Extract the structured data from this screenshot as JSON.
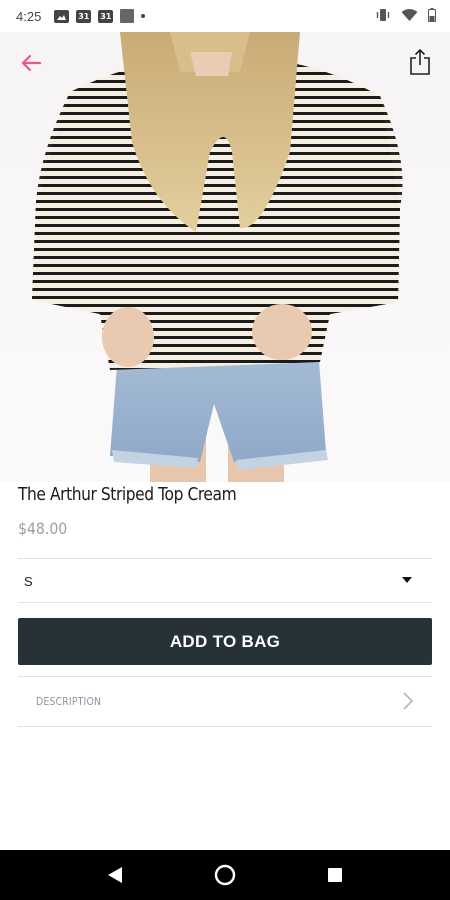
{
  "status_bar": {
    "time": "4:25",
    "icons": [
      "image-icon",
      "calendar-icon",
      "calendar-icon",
      "square-icon",
      "dot-icon",
      "vibrate-icon",
      "wifi-icon",
      "battery-icon"
    ],
    "calendar_day": "31"
  },
  "header": {
    "back_icon": "arrow-left-icon",
    "share_icon": "share-icon",
    "accent_color": "#e8588a"
  },
  "product": {
    "title": "The Arthur Striped Top Cream",
    "price": "$48.00",
    "image": "model-wearing-striped-top-photo"
  },
  "size_selector": {
    "selected": "S"
  },
  "actions": {
    "add_to_bag_label": "ADD TO BAG",
    "button_color": "#263238"
  },
  "description": {
    "label": "DESCRIPTION"
  },
  "nav_bar": {
    "icons": [
      "back-triangle-icon",
      "home-circle-icon",
      "recents-square-icon"
    ]
  }
}
